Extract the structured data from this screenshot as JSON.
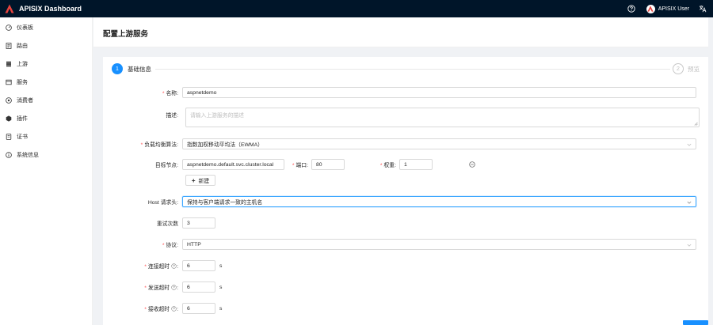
{
  "header": {
    "app_title": "APISIX Dashboard",
    "user_name": "APISIX User",
    "brand_color": "#e8433e",
    "bg_color": "#001529"
  },
  "sidebar": {
    "items": [
      {
        "label": "仪表板",
        "icon": "dashboard-icon"
      },
      {
        "label": "路由",
        "icon": "route-icon"
      },
      {
        "label": "上游",
        "icon": "upstream-icon"
      },
      {
        "label": "服务",
        "icon": "service-icon"
      },
      {
        "label": "消费者",
        "icon": "consumer-icon"
      },
      {
        "label": "插件",
        "icon": "plugin-icon"
      },
      {
        "label": "证书",
        "icon": "certificate-icon"
      },
      {
        "label": "系统信息",
        "icon": "info-icon"
      }
    ]
  },
  "page": {
    "title": "配置上游服务"
  },
  "steps": [
    {
      "number": "1",
      "label": "基础信息"
    },
    {
      "number": "2",
      "label": "预览"
    }
  ],
  "form": {
    "name": {
      "label": "名称:",
      "value": "aspnetdemo"
    },
    "description": {
      "label": "描述:",
      "placeholder": "请输入上游服务的描述"
    },
    "lb_algorithm": {
      "label": "负载均衡算法:",
      "value": "指数加权移动平均法（EWMA）"
    },
    "targets": {
      "label": "目标节点:",
      "host": "aspnetdemo.default.svc.cluster.local",
      "port_label": "端口:",
      "port": "80",
      "weight_label": "权重:",
      "weight": "1"
    },
    "add_button": "新建",
    "host_header": {
      "label": "Host 请求头:",
      "value": "保持与客户端请求一致的主机名"
    },
    "retries": {
      "label": "重试次数",
      "value": "3"
    },
    "protocol": {
      "label": "协议:",
      "value": "HTTP"
    },
    "connect_timeout": {
      "label": "连接超时",
      "value": "6",
      "unit": "s"
    },
    "send_timeout": {
      "label": "发送超时",
      "value": "6",
      "unit": "s"
    },
    "read_timeout": {
      "label": "接收超时",
      "value": "6",
      "unit": "s"
    }
  },
  "colors": {
    "primary": "#1890ff",
    "required": "#ff4d4f"
  }
}
